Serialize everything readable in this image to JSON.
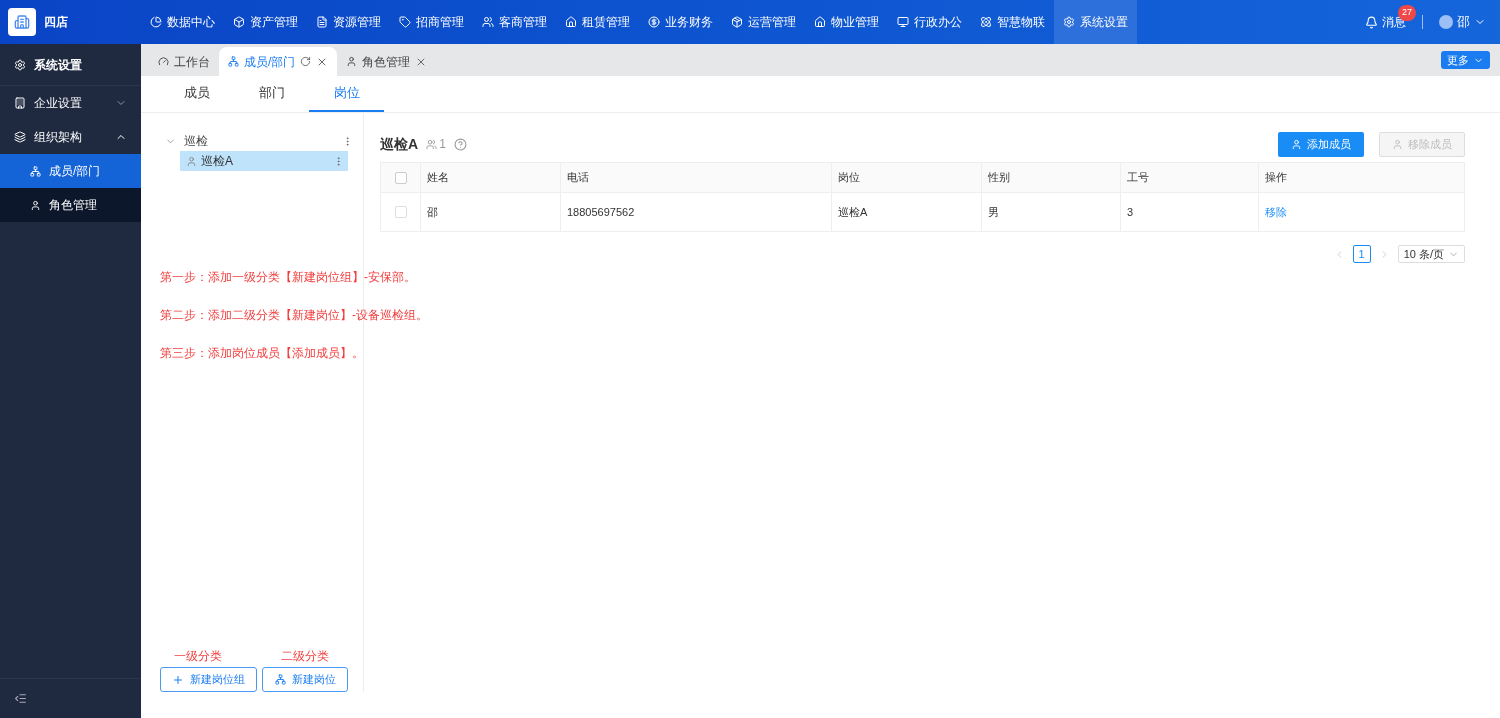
{
  "header": {
    "brand": "四店",
    "menu": [
      {
        "label": "数据中心",
        "selected": false
      },
      {
        "label": "资产管理",
        "selected": false
      },
      {
        "label": "资源管理",
        "selected": false
      },
      {
        "label": "招商管理",
        "selected": false
      },
      {
        "label": "客商管理",
        "selected": false
      },
      {
        "label": "租赁管理",
        "selected": false
      },
      {
        "label": "业务财务",
        "selected": false
      },
      {
        "label": "运营管理",
        "selected": false
      },
      {
        "label": "物业管理",
        "selected": false
      },
      {
        "label": "行政办公",
        "selected": false
      },
      {
        "label": "智慧物联",
        "selected": false
      },
      {
        "label": "系统设置",
        "selected": true
      }
    ],
    "messages": {
      "label": "消息",
      "count": "27"
    },
    "user": {
      "name": "邵"
    }
  },
  "sidebar": {
    "title": "系统设置",
    "items": [
      {
        "label": "企业设置",
        "expanded": false
      },
      {
        "label": "组织架构",
        "expanded": true,
        "children": [
          {
            "label": "成员/部门",
            "selected": true
          },
          {
            "label": "角色管理",
            "selected": false
          }
        ]
      }
    ]
  },
  "page_tabs": [
    {
      "label": "工作台",
      "selected": false,
      "closable": false
    },
    {
      "label": "成员/部门",
      "selected": true,
      "closable": true
    },
    {
      "label": "角色管理",
      "selected": false,
      "closable": true
    }
  ],
  "more_button": "更多",
  "sub_tabs": [
    {
      "label": "成员",
      "selected": false
    },
    {
      "label": "部门",
      "selected": false
    },
    {
      "label": "岗位",
      "selected": true
    }
  ],
  "tree": [
    {
      "label": "巡检",
      "expanded": true,
      "selected": false,
      "children": [
        {
          "label": "巡检A",
          "selected": true
        }
      ]
    }
  ],
  "annotations": [
    "第一步：添加一级分类【新建岗位组】-安保部。",
    "第二步：添加二级分类【新建岗位】-设备巡检组。",
    "第三步：添加岗位成员【添加成员】。"
  ],
  "bottom_buttons": [
    {
      "caption": "一级分类",
      "label": "新建岗位组"
    },
    {
      "caption": "二级分类",
      "label": "新建岗位"
    }
  ],
  "detail": {
    "title": "巡检A",
    "member_count": "1",
    "add_button": {
      "label": "添加成员",
      "disabled": false
    },
    "remove_button": {
      "label": "移除成员",
      "disabled": true
    },
    "table": {
      "columns": [
        "姓名",
        "电话",
        "岗位",
        "性别",
        "工号",
        "操作"
      ],
      "select_all_checked": false,
      "rows": [
        {
          "checked": false,
          "cells": [
            "邵",
            "18805697562",
            "巡检A",
            "男",
            "3"
          ],
          "action": "移除"
        }
      ]
    },
    "pagination": {
      "pages": [
        {
          "label": "1",
          "selected": true
        }
      ],
      "page_size": "10 条/页"
    }
  }
}
